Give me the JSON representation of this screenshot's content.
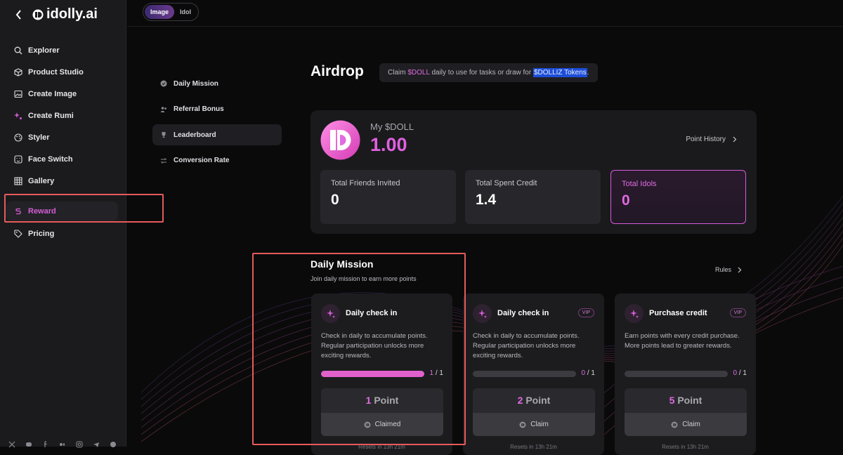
{
  "brand": {
    "name": "idolly.ai"
  },
  "sidebar": {
    "items": [
      {
        "label": "Explorer",
        "icon": "search-icon"
      },
      {
        "label": "Product Studio",
        "icon": "box-icon"
      },
      {
        "label": "Create Image",
        "icon": "image-icon"
      },
      {
        "label": "Create Rumi",
        "icon": "sparkle-icon"
      },
      {
        "label": "Styler",
        "icon": "palette-icon"
      },
      {
        "label": "Face Switch",
        "icon": "face-switch-icon"
      },
      {
        "label": "Gallery",
        "icon": "grid-icon"
      },
      {
        "label": "Reward",
        "icon": "reward-icon",
        "active": true
      },
      {
        "label": "Pricing",
        "icon": "tag-icon"
      }
    ],
    "socials": [
      "x-icon",
      "discord-icon",
      "facebook-icon",
      "medium-icon",
      "instagram-icon",
      "telegram-icon",
      "github-icon"
    ]
  },
  "topbar": {
    "toggle": [
      "Image",
      "Idol"
    ],
    "selected": "Image"
  },
  "subnav": {
    "items": [
      {
        "label": "Daily Mission",
        "icon": "check-circle-icon"
      },
      {
        "label": "Referral Bonus",
        "icon": "users-icon"
      },
      {
        "label": "Leaderboard",
        "icon": "trophy-icon",
        "active": true
      },
      {
        "label": "Conversion Rate",
        "icon": "swap-icon"
      }
    ]
  },
  "page": {
    "title": "Airdrop",
    "banner": {
      "pre": "Claim ",
      "doll": "$DOLL",
      "mid": " daily to use for tasks or draw for ",
      "token": "$DOLLIZ Tokens",
      "post": "."
    }
  },
  "wallet": {
    "label": "My $DOLL",
    "value": "1.00",
    "point_history": "Point History",
    "stats": [
      {
        "label": "Total Friends Invited",
        "value": "0"
      },
      {
        "label": "Total Spent Credit",
        "value": "1.4"
      },
      {
        "label": "Total Idols",
        "value": "0"
      }
    ]
  },
  "daily_mission": {
    "title": "Daily Mission",
    "subtitle": "Join daily mission to earn more points",
    "rules": "Rules",
    "cards": [
      {
        "name": "Daily check in",
        "vip": "",
        "desc": "Check in daily to accumulate points. Regular participation unlocks more exciting rewards.",
        "done": "1",
        "total": " / 1",
        "progress": 1.0,
        "points": "1",
        "points_label": " Point",
        "button": "Claimed",
        "footer": "Resets in 13h 21m"
      },
      {
        "name": "Daily check in",
        "vip": "VIP",
        "desc": "Check in daily to accumulate points. Regular participation unlocks more exciting rewards.",
        "done": "0",
        "total": " / 1",
        "progress": 0.0,
        "points": "2",
        "points_label": " Point",
        "button": "Claim",
        "footer": "Resets in 13h 21m"
      },
      {
        "name": "Purchase credit",
        "vip": "VIP",
        "desc": "Earn points with every credit purchase. More points lead to greater rewards.",
        "done": "0",
        "total": " / 1",
        "progress": 0.0,
        "points": "5",
        "points_label": " Point",
        "button": "Claim",
        "footer": "Resets in 13h 21m"
      }
    ]
  },
  "colors": {
    "accent": "#e060e0",
    "highlight_box": "#e65a5a",
    "background": "#0a0a0b"
  }
}
